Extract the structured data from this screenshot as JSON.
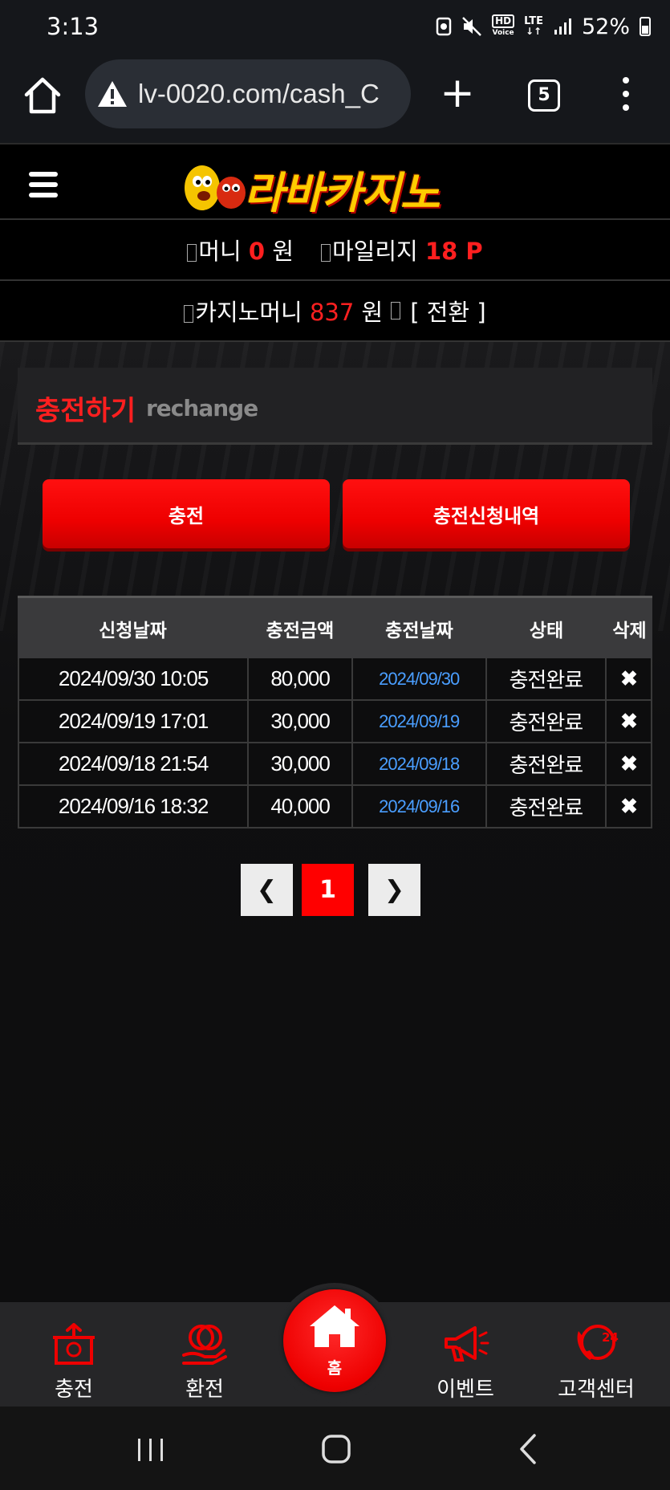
{
  "status_bar": {
    "time": "3:13",
    "hd_label": "HD",
    "voice_label": "Voice",
    "lte_label": "LTE",
    "battery_text": "52%"
  },
  "browser": {
    "url": "lv-0020.com/cash_C",
    "tab_count": "5"
  },
  "site": {
    "logo_text": "라바카지노",
    "money_label": "머니",
    "money_value": "0",
    "won_unit": "원",
    "mileage_label": "마일리지",
    "mileage_value": "18 P",
    "casino_money_label": "카지노머니",
    "casino_money_value": "837",
    "convert_label": "[ 전환 ]"
  },
  "section": {
    "title": "충전하기",
    "subtitle": "rechange"
  },
  "buttons": {
    "charge": "충전",
    "history": "충전신청내역"
  },
  "table": {
    "headers": [
      "신청날짜",
      "충전금액",
      "충전날짜",
      "상태",
      "삭제"
    ],
    "rows": [
      {
        "request_date": "2024/09/30 10:05",
        "amount": "80,000",
        "charge_date": "2024/09/30",
        "status": "충전완료",
        "delete": "✖"
      },
      {
        "request_date": "2024/09/19 17:01",
        "amount": "30,000",
        "charge_date": "2024/09/19",
        "status": "충전완료",
        "delete": "✖"
      },
      {
        "request_date": "2024/09/18 21:54",
        "amount": "30,000",
        "charge_date": "2024/09/18",
        "status": "충전완료",
        "delete": "✖"
      },
      {
        "request_date": "2024/09/16 18:32",
        "amount": "40,000",
        "charge_date": "2024/09/16",
        "status": "충전완료",
        "delete": "✖"
      }
    ]
  },
  "pagination": {
    "prev": "❮",
    "current": "1",
    "next": "❯"
  },
  "bottom_nav": {
    "charge": "충전",
    "exchange": "환전",
    "home": "홈",
    "event": "이벤트",
    "support": "고객센터",
    "support_badge": "24"
  },
  "colors": {
    "accent_red": "#ff0000",
    "link_blue": "#4a9eff",
    "logo_yellow": "#ffcc00"
  }
}
